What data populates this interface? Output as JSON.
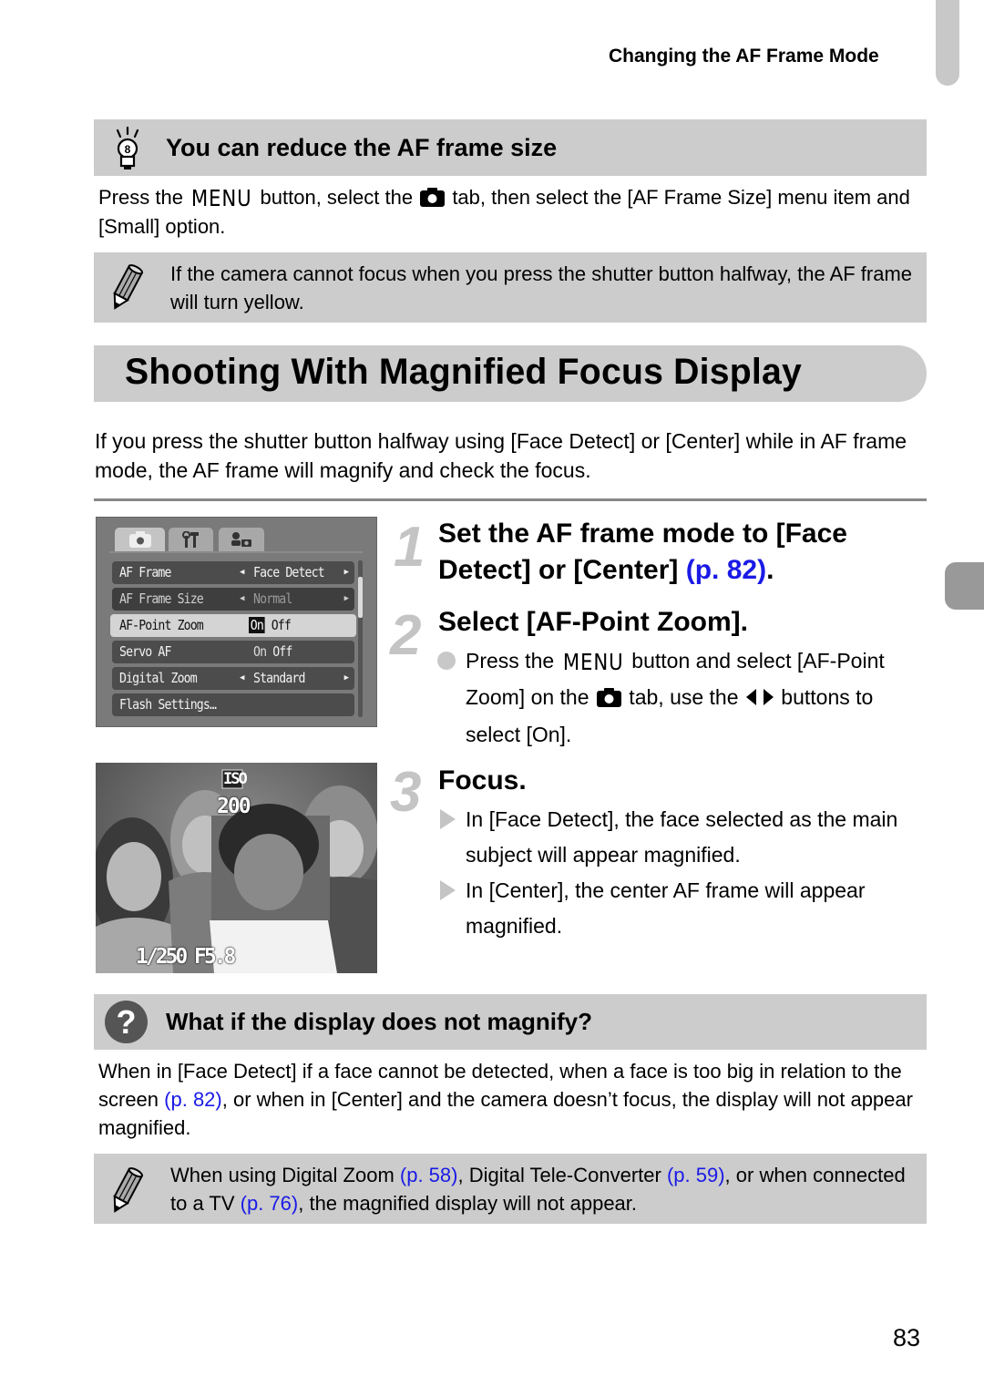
{
  "running_header": "Changing the AF Frame Mode",
  "tip": {
    "icon": "lightbulb-icon",
    "title": "You can reduce the AF frame size",
    "body_prefix": "Press the ",
    "menu_word": "MENU",
    "body_middle": " button, select the ",
    "tab_icon": "camera-icon",
    "body_suffix": " tab, then select the [AF Frame Size] menu item and [Small] option."
  },
  "note1": {
    "icon": "pencil-icon",
    "text": "If the camera cannot focus when you press the shutter button halfway, the AF frame will turn yellow."
  },
  "section": {
    "title": "Shooting With Magnified Focus Display",
    "intro": "If you press the shutter button halfway using [Face Detect] or [Center] while in AF frame mode, the AF frame will magnify and check the focus."
  },
  "camera_menu": {
    "tabs": [
      {
        "icon": "camera-icon",
        "active": true
      },
      {
        "icon": "wrench-icon",
        "active": false
      },
      {
        "icon": "my-settings-icon",
        "active": false
      }
    ],
    "rows": [
      {
        "label": "AF Frame",
        "value": "Face Detect",
        "arrows": true,
        "dim": false,
        "selected": false
      },
      {
        "label": "AF Frame Size",
        "value": "Normal",
        "arrows": true,
        "dim": true,
        "selected": false
      },
      {
        "label": "AF-Point Zoom",
        "on": "On",
        "off": "Off",
        "on_selected": true,
        "selected": true
      },
      {
        "label": "Servo AF",
        "on": "On",
        "off": "Off",
        "on_selected": false,
        "selected": false
      },
      {
        "label": "Digital Zoom",
        "value": "Standard",
        "arrows": true,
        "dim": false,
        "selected": false
      },
      {
        "label": "Flash Settings…",
        "value": "",
        "arrows": false,
        "dim": false,
        "selected": false
      }
    ]
  },
  "photo": {
    "iso_label": "ISO",
    "iso_value": "200",
    "shutter": "1/250",
    "aperture": "F5.8"
  },
  "steps": [
    {
      "number": "1",
      "title": "Set the AF frame mode to [Face Detect] or [Center]",
      "link": "(p. 82)",
      "title_end": "."
    },
    {
      "number": "2",
      "title": "Select [AF-Point Zoom].",
      "bullet_prefix": "Press the ",
      "menu_word": "MENU",
      "bullet_middle": " button and select [AF-Point Zoom] on the ",
      "bullet_middle2": " tab, use the ",
      "arrows_icon": "left-right-arrows-icon",
      "bullet_suffix": " buttons to select [On]."
    },
    {
      "number": "3",
      "title": "Focus.",
      "results": [
        "In [Face Detect], the face selected as the main subject will appear magnified.",
        "In [Center], the center AF frame will appear magnified."
      ]
    }
  ],
  "question": {
    "icon": "question-icon",
    "icon_glyph": "?",
    "title": "What if the display does not magnify?",
    "body_prefix": "When in [Face Detect] if a face cannot be detected, when a face is too big in relation to the screen ",
    "link": "(p. 82)",
    "body_suffix": ", or when in [Center] and the camera doesn’t focus, the display will not appear magnified."
  },
  "note2": {
    "icon": "pencil-icon",
    "part1": "When using Digital Zoom ",
    "link1": "(p. 58)",
    "part2": ", Digital Tele-Converter ",
    "link2": "(p. 59)",
    "part3": ", or when connected to a TV ",
    "link3": "(p. 76)",
    "part4": ", the magnified display will not appear."
  },
  "page_number": "83",
  "colors": {
    "link": "#1a1ae6",
    "box_gray": "#cccccc",
    "step_number": "#c4c4c4"
  }
}
